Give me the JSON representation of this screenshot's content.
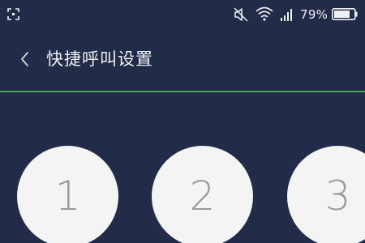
{
  "status_bar": {
    "battery_percent": "79%",
    "battery_level": 0.79,
    "icons": [
      "fullscreen-icon",
      "mute-icon",
      "wifi-icon",
      "signal-icon",
      "battery-icon"
    ]
  },
  "header": {
    "title": "快捷呼叫设置",
    "back_icon": "chevron-left-icon",
    "divider_color": "#3fa654"
  },
  "speed_dials": [
    {
      "label": "1"
    },
    {
      "label": "2"
    },
    {
      "label": "3"
    }
  ],
  "colors": {
    "background": "#222c48",
    "dial_circle": "#f4f4f4",
    "dial_text": "#9a9a9a",
    "accent": "#3fa654"
  }
}
